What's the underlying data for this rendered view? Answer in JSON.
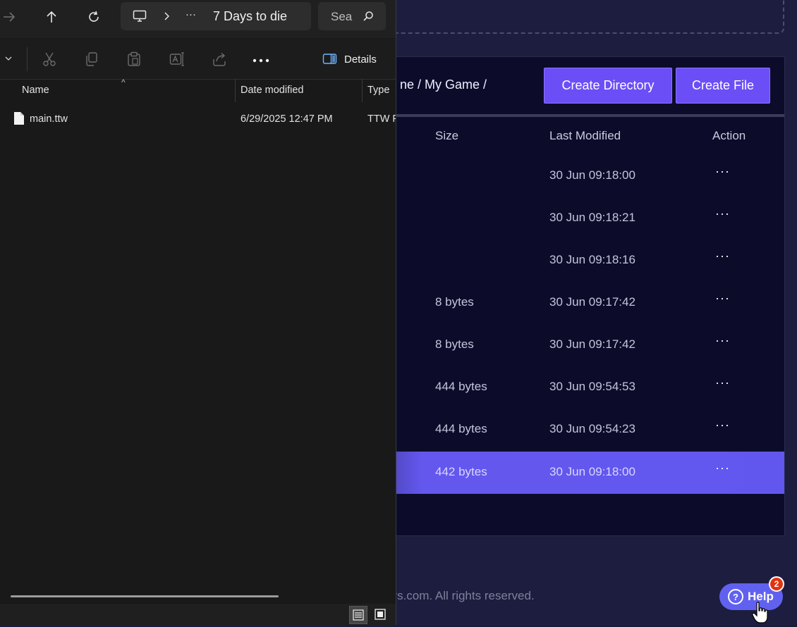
{
  "web": {
    "breadcrumb": "ne / My Game /",
    "buttons": {
      "create_directory": "Create Directory",
      "create_file": "Create File"
    },
    "columns": {
      "size": "Size",
      "last_modified": "Last Modified",
      "action": "Action"
    },
    "rows": [
      {
        "size": "",
        "modified": "30 Jun 09:18:00",
        "action": "···"
      },
      {
        "size": "",
        "modified": "30 Jun 09:18:21",
        "action": "···"
      },
      {
        "size": "",
        "modified": "30 Jun 09:18:16",
        "action": "···"
      },
      {
        "size": "8 bytes",
        "modified": "30 Jun 09:17:42",
        "action": "···"
      },
      {
        "size": "8 bytes",
        "modified": "30 Jun 09:17:42",
        "action": "···"
      },
      {
        "size": "444 bytes",
        "modified": "30 Jun 09:54:53",
        "action": "···"
      },
      {
        "size": "444 bytes",
        "modified": "30 Jun 09:54:23",
        "action": "···"
      },
      {
        "size": "442 bytes",
        "modified": "30 Jun 09:18:00",
        "action": "···",
        "selected": true
      }
    ],
    "footer": "ayers.com. All rights reserved.",
    "help": {
      "label": "Help",
      "badge": "2"
    },
    "colors": {
      "accent": "#6c4ef6",
      "selected_row": "#6157ef",
      "panel_bg": "#0c0c2a",
      "badge": "#e4330f"
    }
  },
  "explorer": {
    "address": {
      "text": "7 Days to die",
      "overflow": "···"
    },
    "search": {
      "placeholder": "Sea"
    },
    "details_label": "Details",
    "headers": {
      "name": "Name",
      "date": "Date modified",
      "type": "Type"
    },
    "files": [
      {
        "name": "main.ttw",
        "date": "6/29/2025 12:47 PM",
        "type": "TTW F"
      }
    ]
  }
}
